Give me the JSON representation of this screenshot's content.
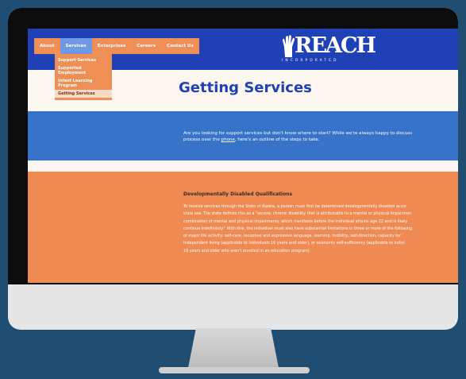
{
  "nav": {
    "items": [
      "About",
      "Services",
      "Enterprises",
      "Careers",
      "Contact Us"
    ],
    "active_index": 1
  },
  "dropdown": {
    "items": [
      "Support Services",
      "Supported Employment",
      "Infant Learning Program",
      "Getting Services"
    ],
    "active_index": 3
  },
  "logo": {
    "text": "REACH",
    "sub": "INCORPORATED"
  },
  "page": {
    "title": "Getting Services"
  },
  "intro": {
    "line1": "Are you looking for support services but don't know where to start? While we're always happy to discuss",
    "line2_before": "process over the ",
    "line2_link": "phone",
    "line2_after": ", here's an outline of the steps to take."
  },
  "section": {
    "heading": "Developmentally Disabled Qualifications",
    "lines": [
      "To receive services through the State of Alaska, a person must first be determined developmentally disabled accor",
      "state law. The state defines this as a \"severe, chronic disability that is attributable to a mental or physical impairmen",
      "combination of mental and physical impairments, which manifests before the individual attains age 22 and is likely",
      "continue indefinitely.\" With this, the individual must also have substantial limitations in three or more of the following",
      "of major life activity: self-care, receptive and expressive language, learning, mobility, self-direction, capacity for",
      "independent living (applicable to individuals 16 years and older), or economic self-sufficiency (applicable to indivi",
      "16 years and older who aren't enrolled in an education program)."
    ]
  },
  "colors": {
    "background": "#1f4e72",
    "header_blue": "#1f41b5",
    "accent_orange": "#ee8a52",
    "intro_blue": "#3773c8",
    "cream": "#fdf7f2"
  }
}
